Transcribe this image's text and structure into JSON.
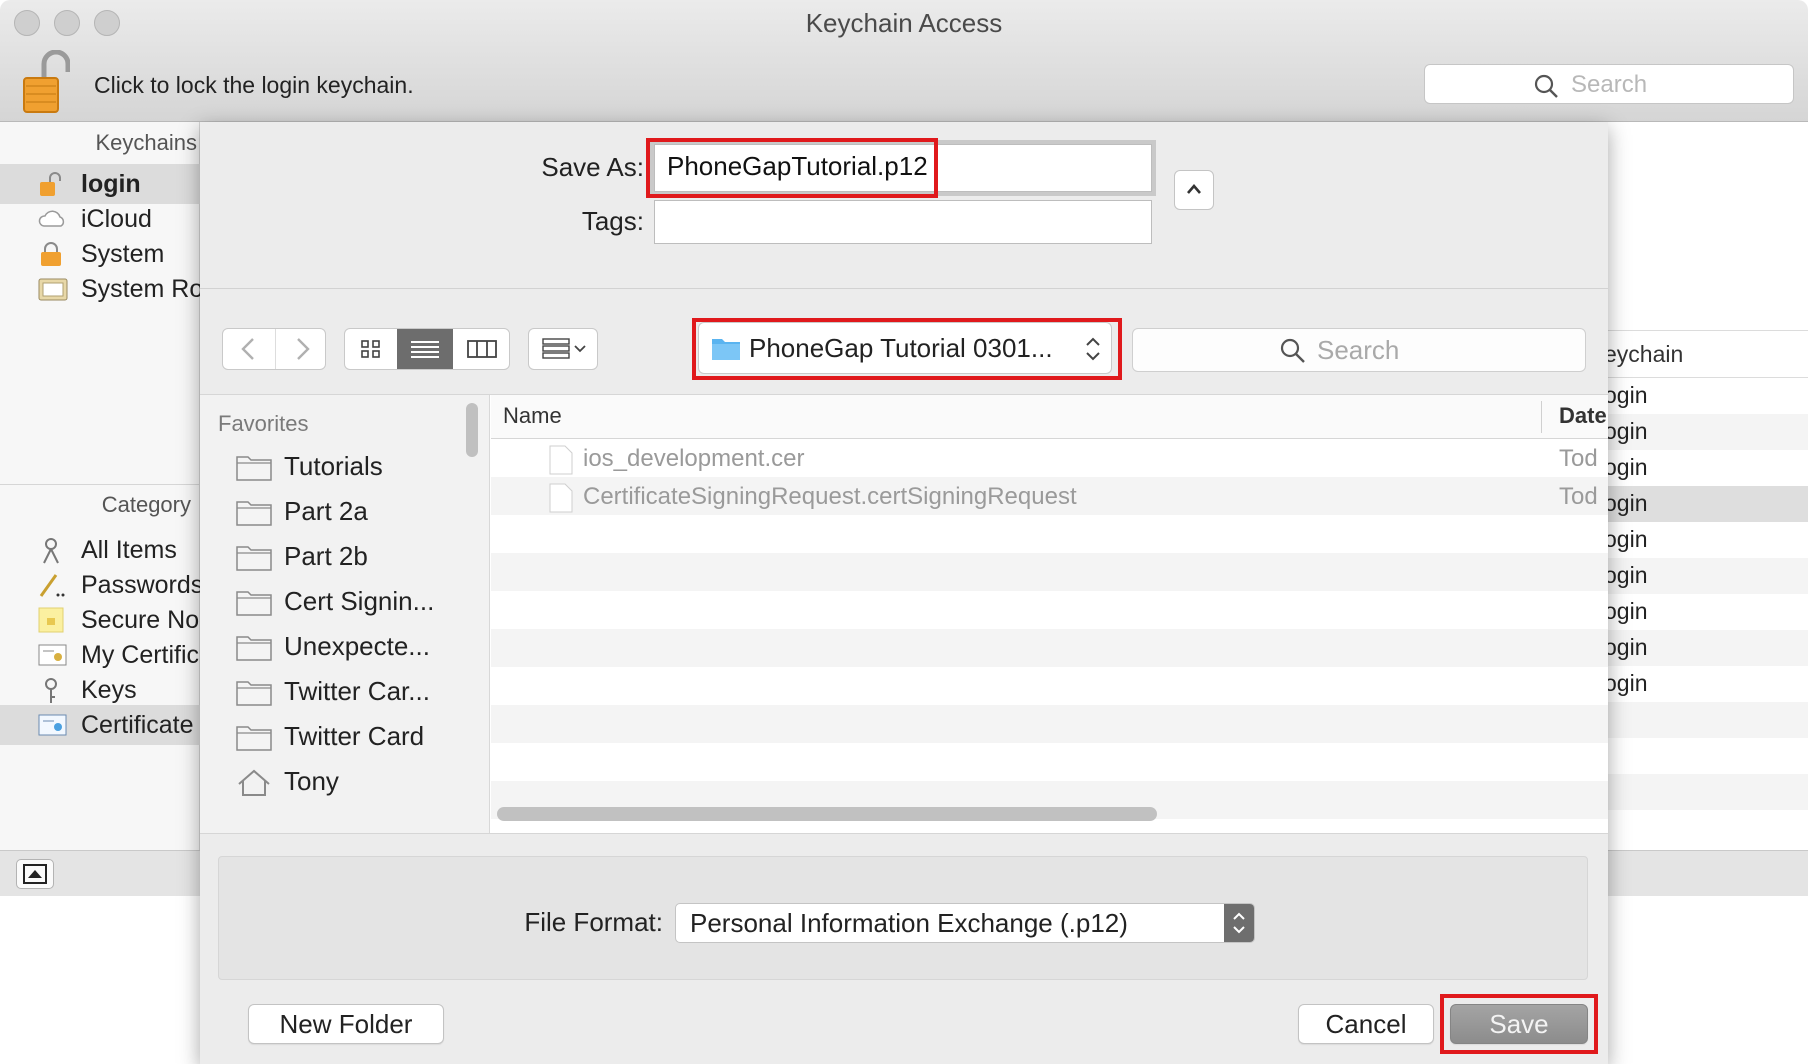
{
  "window": {
    "title": "Keychain Access",
    "lock_message": "Click to lock the login keychain.",
    "search_placeholder": "Search"
  },
  "sidebar": {
    "keychains_header": "Keychains",
    "keychains": [
      {
        "label": "login",
        "icon": "unlocked-padlock-icon",
        "selected": true
      },
      {
        "label": "iCloud",
        "icon": "cloud-icon",
        "selected": false
      },
      {
        "label": "System",
        "icon": "locked-padlock-icon",
        "selected": false
      },
      {
        "label": "System Ro",
        "icon": "certificate-folder-icon",
        "selected": false
      }
    ],
    "category_header": "Category",
    "categories": [
      {
        "label": "All Items",
        "icon": "keys-icon",
        "selected": false
      },
      {
        "label": "Passwords",
        "icon": "pen-icon",
        "selected": false
      },
      {
        "label": "Secure No",
        "icon": "secure-note-icon",
        "selected": false
      },
      {
        "label": "My Certific",
        "icon": "my-certificate-icon",
        "selected": false
      },
      {
        "label": "Keys",
        "icon": "key-icon",
        "selected": false
      },
      {
        "label": "Certificate",
        "icon": "certificate-icon",
        "selected": true
      }
    ]
  },
  "background_table": {
    "header": "eychain",
    "rows": [
      "ogin",
      "ogin",
      "ogin",
      "ogin",
      "ogin",
      "ogin",
      "ogin",
      "ogin",
      "ogin"
    ]
  },
  "save_dialog": {
    "save_as_label": "Save As:",
    "save_as_value": "PhoneGapTutorial.p12",
    "tags_label": "Tags:",
    "tags_value": "",
    "location": "PhoneGap Tutorial 0301...",
    "search_placeholder": "Search",
    "sidebar_title": "Favorites",
    "favorites": [
      {
        "label": "Tutorials",
        "icon": "folder-icon"
      },
      {
        "label": "Part 2a",
        "icon": "folder-icon"
      },
      {
        "label": "Part 2b",
        "icon": "folder-icon"
      },
      {
        "label": "Cert Signin...",
        "icon": "folder-icon"
      },
      {
        "label": "Unexpecte...",
        "icon": "folder-icon"
      },
      {
        "label": "Twitter Car...",
        "icon": "folder-icon"
      },
      {
        "label": "Twitter Card",
        "icon": "folder-icon"
      },
      {
        "label": "Tony",
        "icon": "home-icon"
      }
    ],
    "columns": {
      "name": "Name",
      "date": "Date"
    },
    "files": [
      {
        "name": "ios_development.cer",
        "date": "Tod"
      },
      {
        "name": "CertificateSigningRequest.certSigningRequest",
        "date": "Tod"
      }
    ],
    "file_format_label": "File Format:",
    "file_format_value": "Personal Information Exchange (.p12)",
    "new_folder_label": "New Folder",
    "cancel_label": "Cancel",
    "save_label": "Save"
  },
  "colors": {
    "highlight_red": "#e0191c",
    "folder_blue": "#5ab4f0",
    "lock_orange": "#f0a030"
  }
}
